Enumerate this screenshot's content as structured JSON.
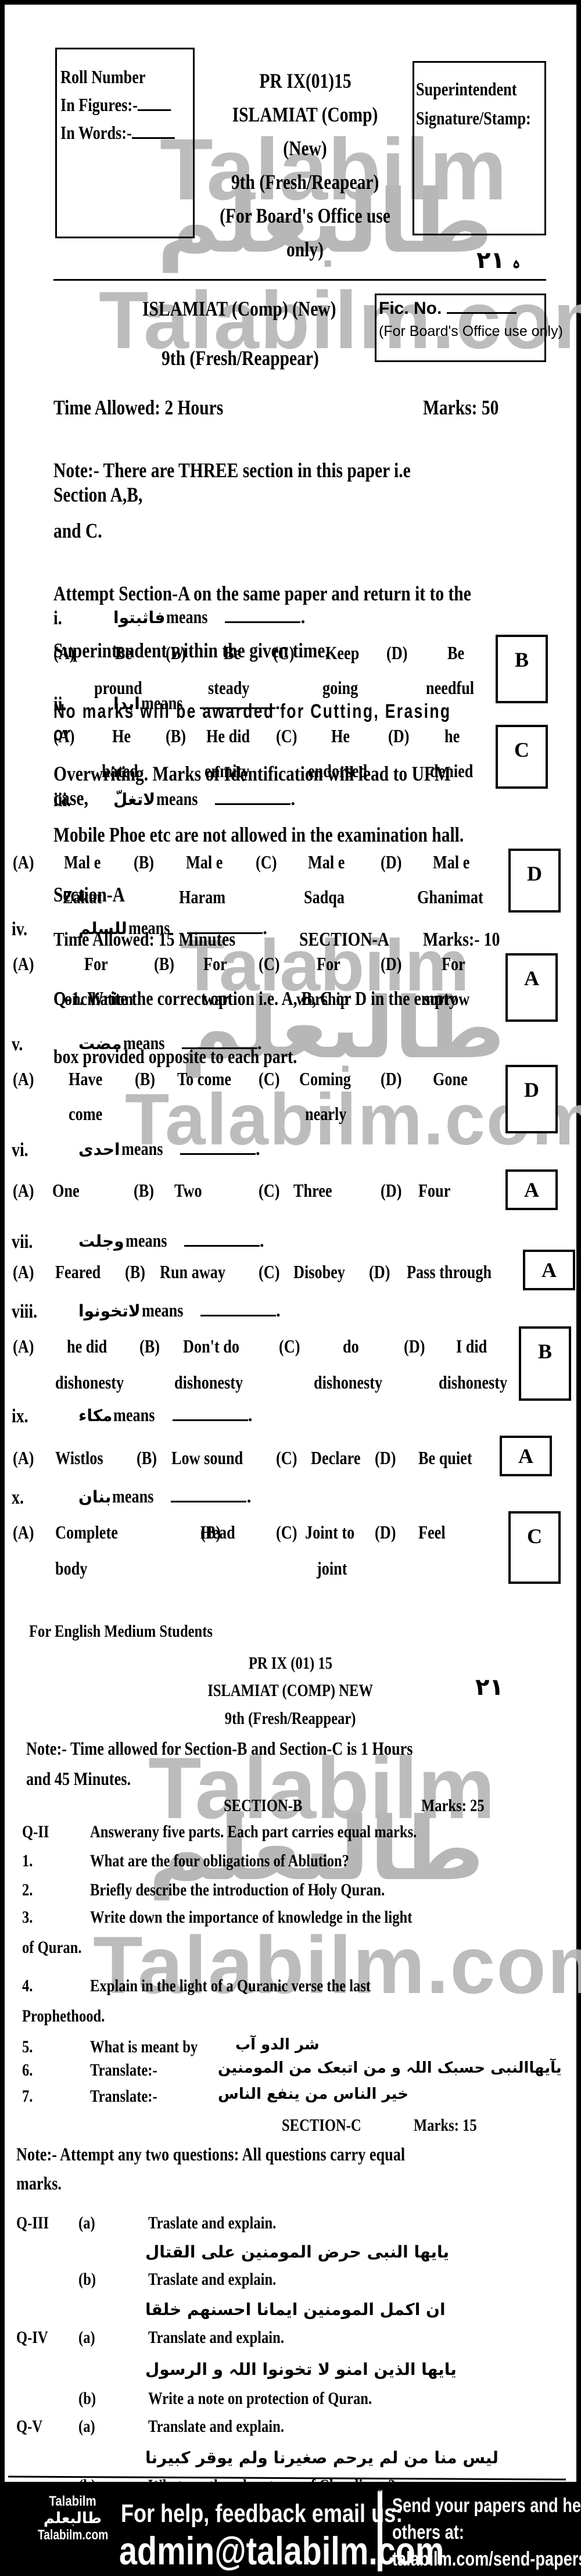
{
  "header": {
    "roll_box": {
      "title": "Roll Number",
      "figures_label": "In Figures:-",
      "words_label": "In Words:-"
    },
    "paper_code": "PR IX(01)15",
    "subject": "ISLAMIAT (Comp) (New)",
    "class": "9th (Fresh/Reapear)",
    "office_note": "(For Board's Office use only)",
    "superintendent_box": {
      "line1": "Superintendent",
      "line2": "Signature/Stamp:"
    },
    "handwritten_mark": "ﮦ ٢١",
    "subject_repeat": "ISLAMIAT (Comp) (New)",
    "class_repeat": "9th (Fresh/Reappear)",
    "fic_box": {
      "label": "Fic. No.",
      "note": "(For Board's Office use only)"
    }
  },
  "instructions": {
    "time_allowed": "Time Allowed: 2 Hours",
    "marks": "Marks: 50",
    "note_line1": "Note:-  There are THREE section in this paper i.e Section A,B,",
    "note_line2": "and C.",
    "attempt_line1": "Attempt Section-A on the same paper and return it to the",
    "attempt_line2": "Superintendent within the given time.",
    "rules_line1": "No marks will be awarded for Cutting, Erasing or",
    "rules_line2": "Overwriting. Marks of Identification will lead to UFM case,",
    "rules_line3": "Mobile Phoe etc are not allowed in the examination hall.",
    "section_label": "Section-A"
  },
  "section_a": {
    "time": "Time Allowed: 15 Minutes",
    "title": "SECTION-A",
    "marks": "Marks:- 10",
    "q1_line1": "Q-1.     Write the correct option i.e. A, B, C or D in the empty",
    "q1_line2": "box provided opposite to each part.",
    "means_word": "means",
    "questions": [
      {
        "num": "i.",
        "arabic": "فاثبتوا",
        "options": [
          {
            "letter": "(A)",
            "line1": "Be",
            "line2": "pround"
          },
          {
            "letter": "(B)",
            "line1": "Be",
            "line2": "steady"
          },
          {
            "letter": "(C)",
            "line1": "Keep",
            "line2": "going"
          },
          {
            "letter": "(D)",
            "line1": "Be",
            "line2": "needful"
          }
        ],
        "answer": "B"
      },
      {
        "num": "ii.",
        "arabic": "ابدا",
        "options": [
          {
            "letter": "(A)",
            "line1": "He",
            "line2": "hated"
          },
          {
            "letter": "(B)",
            "line1": "He did",
            "line2": "enmity"
          },
          {
            "letter": "(C)",
            "line1": "He",
            "line2": "endorsed"
          },
          {
            "letter": "(D)",
            "line1": "he",
            "line2": "denied"
          }
        ],
        "answer": "C"
      },
      {
        "num": "iii.",
        "arabic": "لاتغلّ",
        "options": [
          {
            "letter": "(A)",
            "line1": "Mal e",
            "line2": "Zakat"
          },
          {
            "letter": "(B)",
            "line1": "Mal e",
            "line2": "Haram"
          },
          {
            "letter": "(C)",
            "line1": "Mal e",
            "line2": "Sadqa"
          },
          {
            "letter": "(D)",
            "line1": "Mal e",
            "line2": "Ghanimat"
          }
        ],
        "answer": "D"
      },
      {
        "num": "iv.",
        "arabic": "للسلم",
        "options": [
          {
            "letter": "(A)",
            "line1": "For",
            "line2": "Conciliation"
          },
          {
            "letter": "(B)",
            "line1": "For",
            "line2": "war"
          },
          {
            "letter": "(C)",
            "line1": "For",
            "line2": "worship"
          },
          {
            "letter": "(D)",
            "line1": "For",
            "line2": "sorrow"
          }
        ],
        "answer": "A"
      },
      {
        "num": "v.",
        "arabic": "مضت",
        "options": [
          {
            "letter": "(A)",
            "line1": "Have",
            "line2": "come"
          },
          {
            "letter": "(B)",
            "line1": "To come",
            "line2": ""
          },
          {
            "letter": "(C)",
            "line1": "Coming",
            "line2": "nearly"
          },
          {
            "letter": "(D)",
            "line1": "Gone",
            "line2": ""
          }
        ],
        "answer": "D"
      },
      {
        "num": "vi.",
        "arabic": "احدی",
        "options": [
          {
            "letter": "(A)",
            "line1": "One"
          },
          {
            "letter": "(B)",
            "line1": "Two"
          },
          {
            "letter": "(C)",
            "line1": "Three"
          },
          {
            "letter": "(D)",
            "line1": "Four"
          }
        ],
        "answer": "A"
      },
      {
        "num": "vii.",
        "arabic": "وجلت",
        "options": [
          {
            "letter": "(A)",
            "line1": "Feared"
          },
          {
            "letter": "(B)",
            "line1": "Run away"
          },
          {
            "letter": "(C)",
            "line1": "Disobey"
          },
          {
            "letter": "(D)",
            "line1": "Pass through"
          }
        ],
        "answer": "A"
      },
      {
        "num": "viii.",
        "arabic": "لاتخونوا",
        "options": [
          {
            "letter": "(A)",
            "line1": "he did",
            "line2": "dishonesty"
          },
          {
            "letter": "(B)",
            "line1": "Don't do",
            "line2": "dishonesty"
          },
          {
            "letter": "(C)",
            "line1": "do",
            "line2": "dishonesty"
          },
          {
            "letter": "(D)",
            "line1": "I did",
            "line2": "dishonesty"
          }
        ],
        "answer": "B"
      },
      {
        "num": "ix.",
        "arabic": "مکاء",
        "options": [
          {
            "letter": "(A)",
            "line1": "Wistlos"
          },
          {
            "letter": "(B)",
            "line1": "Low sound"
          },
          {
            "letter": "(C)",
            "line1": "Declare"
          },
          {
            "letter": "(D)",
            "line1": "Be quiet"
          }
        ],
        "answer": "A"
      },
      {
        "num": "x.",
        "arabic": "بنان",
        "options": [
          {
            "letter": "(A)",
            "line1": "Complete",
            "line2": "body"
          },
          {
            "letter": "(B)",
            "line1": "Head",
            "line2": ""
          },
          {
            "letter": "(C)",
            "line1": "Joint to",
            "line2": "joint"
          },
          {
            "letter": "(D)",
            "line1": "Feel",
            "line2": ""
          }
        ],
        "answer": "C"
      }
    ]
  },
  "part2": {
    "audience": "For English Medium Students",
    "paper_code": "PR IX (01) 15",
    "subject": "ISLAMIAT (COMP) NEW",
    "class": "9th (Fresh/Reappear)",
    "handwritten_mark": "٢١",
    "note_line1": "Note:-  Time allowed for Section-B and Section-C is 1 Hours",
    "note_line2": "and 45 Minutes."
  },
  "section_b": {
    "title": "SECTION-B",
    "marks": "Marks: 25",
    "q_label": "Q-II",
    "q_text": "Answerany five parts. Each part carries equal marks.",
    "items": [
      {
        "num": "1.",
        "text": "What are the four obligations of Ablution?"
      },
      {
        "num": "2.",
        "text": "Briefly describe the introduction of Holy Quran."
      },
      {
        "num": "3.",
        "text": "Write down the importance of knowledge in the light",
        "cont": "of Quran."
      },
      {
        "num": "4.",
        "text": "Explain in the light of a Quranic verse the last",
        "cont": "Prophethood."
      },
      {
        "num": "5.",
        "text": "What is meant by",
        "arabic": "شر الدو آب"
      },
      {
        "num": "6.",
        "text": "Translate:-",
        "arabic": "یآیھاالنبی حسبک اللہ و من اتبعک من المومنین"
      },
      {
        "num": "7.",
        "text": "Translate:-",
        "arabic": "خیر الناس من ینفع الناس"
      }
    ]
  },
  "section_c": {
    "title": "SECTION-C",
    "marks": "Marks: 15",
    "note_line1": "Note:-  Attempt any two questions: All questions carry equal",
    "note_line2": "marks.",
    "questions": [
      {
        "label": "Q-III",
        "parts": [
          {
            "part": "(a)",
            "text": "Traslate and explain.",
            "arabic": "یایھا النبی حرض المومنین علی القتال"
          },
          {
            "part": "(b)",
            "text": "Traslate and explain.",
            "arabic": "ان اکمل المومنین ایمانا احسنھم خلقا"
          }
        ]
      },
      {
        "label": "Q-IV",
        "parts": [
          {
            "part": "(a)",
            "text": "Translate and explain.",
            "arabic": "یایھا الذین امنو لا تخونوا اللہ و الرسول"
          },
          {
            "part": "(b)",
            "text": "Write a note on protection of Quran."
          }
        ]
      },
      {
        "label": "Q-V",
        "parts": [
          {
            "part": "(a)",
            "text": "Translate and explain.",
            "arabic": "لیس منا من لم یرحم صغیرنا ولم یوقر کبیرنا"
          },
          {
            "part": "(b)",
            "text": "What are the advantages of Cleanliness?"
          }
        ]
      }
    ]
  },
  "watermark": {
    "latin": "Talabilm",
    "latin_com": "Talabilm.com",
    "arabic": "طالبعلم"
  },
  "footer": {
    "logo_top": "Talabilm",
    "logo_arabic": "طالبعلم",
    "logo_bottom": "Talabilm.com",
    "help_text": "For help, feedback email us:",
    "email": "admin@talabilm.com",
    "send_line1": "Send your papers and help",
    "send_line2": "others at:",
    "send_link": "talabilm.com/send-papers"
  }
}
